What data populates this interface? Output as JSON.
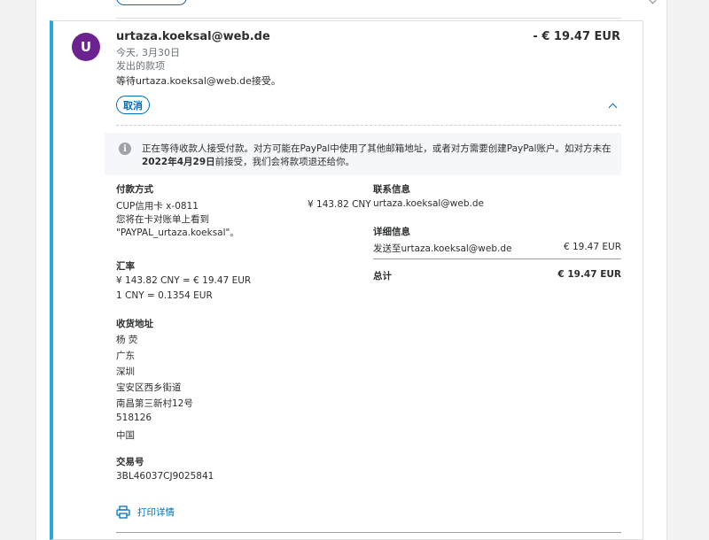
{
  "transaction": {
    "avatar_initial": "U",
    "name": "urtaza.koeksal@web.de",
    "amount": "- € 19.47 EUR",
    "date": "今天, 3月30日",
    "type": "发出的款项",
    "status": "等待urtaza.koeksal@web.de接受。",
    "cancel_label": "取消"
  },
  "notice": {
    "text_before": "正在等待收款人接受付款。对方可能在PayPal中使用了其他邮箱地址，或者对方需要创建PayPal账户。如对方未在",
    "deadline": "2022年4月29日",
    "text_after": "前接受，我们会将款项退还给你。"
  },
  "payment": {
    "heading": "付款方式",
    "card": "CUP信用卡 x-0811",
    "card_amount": "¥ 143.82 CNY",
    "statement_line1": "您将在卡对账单上看到",
    "statement_line2": "\"PAYPAL_urtaza.koeksal\"。"
  },
  "exchange": {
    "heading": "汇率",
    "line1": "¥ 143.82 CNY = € 19.47 EUR",
    "line2": "1 CNY = 0.1354 EUR"
  },
  "shipping": {
    "heading": "收货地址",
    "lines": [
      "杨 荧",
      "广东",
      "深圳",
      "宝安区西乡街道",
      "南昌第三新村12号",
      "518126",
      "中国"
    ]
  },
  "transaction_id": {
    "heading": "交易号",
    "value": "3BL46037CJ9025841"
  },
  "contact": {
    "heading": "联系信息",
    "email": "urtaza.koeksal@web.de"
  },
  "details": {
    "heading": "详细信息",
    "row_label": "发送至urtaza.koeksal@web.de",
    "row_amount": "€ 19.47 EUR",
    "total_label": "总计",
    "total_amount": "€ 19.47 EUR"
  },
  "print_label": "打印详情",
  "colors": {
    "accent": "#0070ba",
    "card_border": "#29a8e0",
    "avatar_bg": "#6c2390"
  }
}
